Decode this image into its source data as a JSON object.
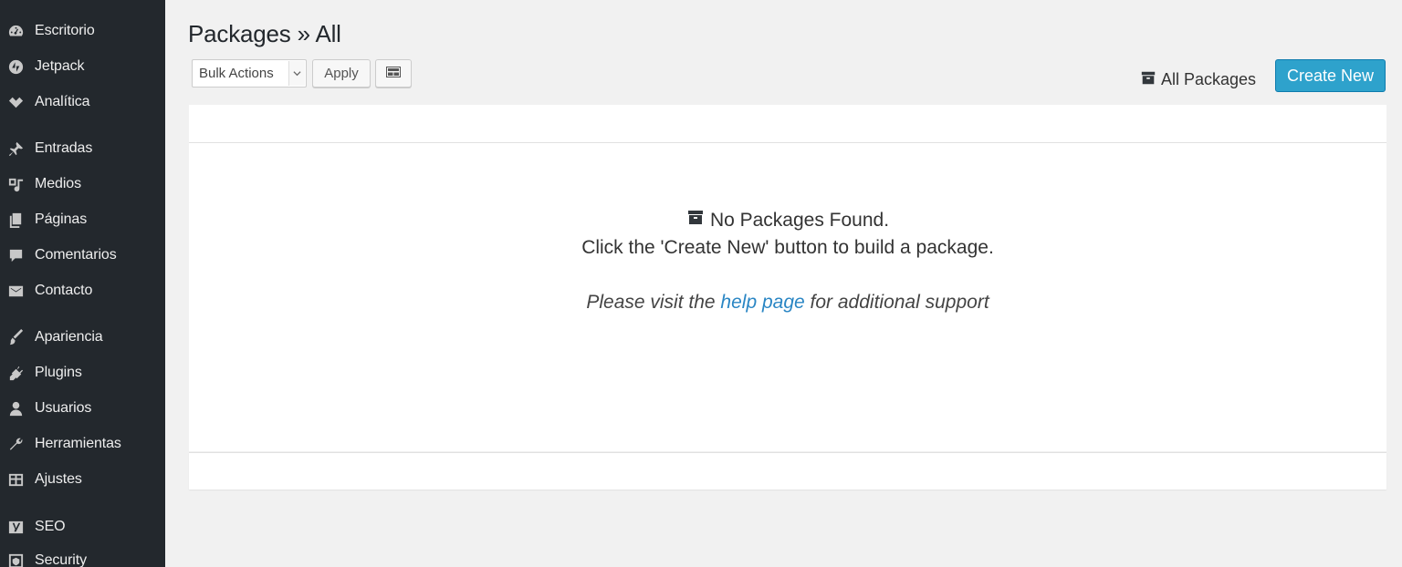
{
  "sidebar": {
    "items": [
      {
        "label": "Escritorio",
        "icon": "dashboard-icon"
      },
      {
        "label": "Jetpack",
        "icon": "jetpack-icon"
      },
      {
        "label": "Analítica",
        "icon": "analytics-icon"
      },
      {
        "label": "Entradas",
        "icon": "pin-icon"
      },
      {
        "label": "Medios",
        "icon": "media-icon"
      },
      {
        "label": "Páginas",
        "icon": "pages-icon"
      },
      {
        "label": "Comentarios",
        "icon": "comment-icon"
      },
      {
        "label": "Contacto",
        "icon": "mail-icon"
      },
      {
        "label": "Apariencia",
        "icon": "brush-icon"
      },
      {
        "label": "Plugins",
        "icon": "plugin-icon"
      },
      {
        "label": "Usuarios",
        "icon": "user-icon"
      },
      {
        "label": "Herramientas",
        "icon": "wrench-icon"
      },
      {
        "label": "Ajustes",
        "icon": "settings-icon"
      },
      {
        "label": "SEO",
        "icon": "seo-icon"
      },
      {
        "label": "Security",
        "icon": "security-icon"
      }
    ]
  },
  "page": {
    "title": "Packages » All"
  },
  "toolbar": {
    "bulk_actions_value": "Bulk Actions",
    "apply_label": "Apply",
    "grid_icon": "grid-icon"
  },
  "header_actions": {
    "all_packages_label": "All Packages",
    "all_packages_icon": "archive-icon",
    "create_new_label": "Create New"
  },
  "empty_state": {
    "title": "No Packages Found.",
    "subtitle": "Click the 'Create New' button to build a package.",
    "help_prefix": "Please visit the ",
    "help_link": "help page",
    "help_suffix": " for additional support"
  },
  "colors": {
    "sidebar_bg": "#23282d",
    "accent": "#2ea2cc",
    "link": "#2a86c4",
    "page_bg": "#f1f1f1"
  }
}
